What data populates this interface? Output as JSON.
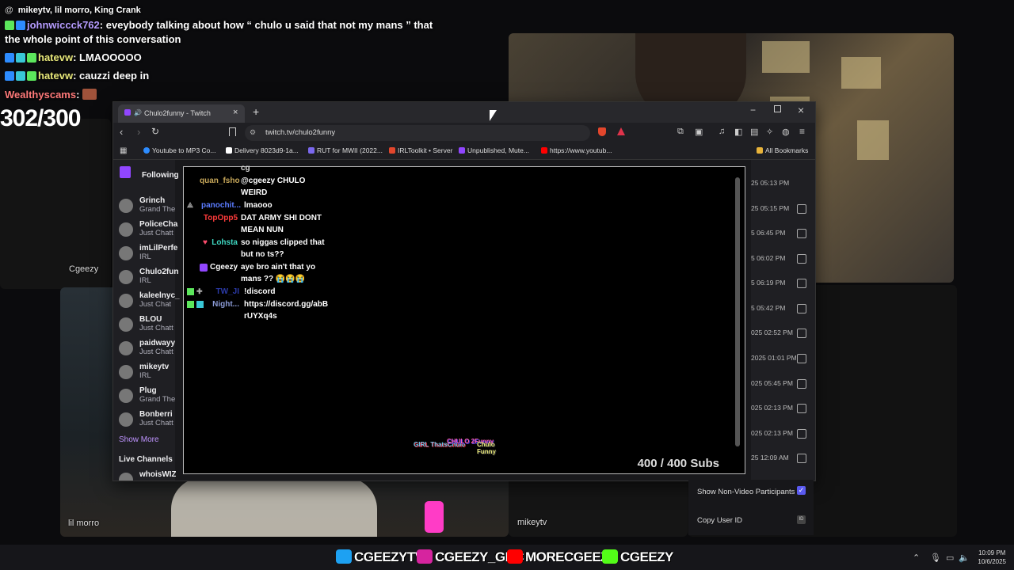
{
  "overlay_chat": {
    "header": "mikeytv, lil morro, King Crank",
    "messages": [
      {
        "user": "johnwiccck762",
        "text": "eveybody talking about how “ chulo u said that not my mans ” that",
        "cont": "the whole point of this conversation",
        "color": "#b69cff"
      },
      {
        "user": "hatevw",
        "text": "LMAOOOOO",
        "color": "#e8e87a"
      },
      {
        "user": "hatevw",
        "text": "cauzzi deep in",
        "color": "#e8e87a"
      },
      {
        "user": "Wealthyscams",
        "text": "",
        "color": "#ff7a7a"
      }
    ],
    "counter": "302/300"
  },
  "tiles": {
    "cgeezy": "Cgeezy",
    "lil_morro": "lil morro",
    "mikeytv": "mikeytv"
  },
  "browser": {
    "tab_title": "Chulo2funny - Twitch",
    "new_tab": "+",
    "url": "twitch.tv/chulo2funny",
    "bookmarks": [
      "Youtube to MP3 Co...",
      "Delivery 8023d9-1a...",
      "RUT for MWII (2022...",
      "IRLToolkit • Server",
      "Unpublished, Mute...",
      "https://www.youtub..."
    ],
    "all_bookmarks": "All Bookmarks"
  },
  "sidebar": {
    "following": "Following",
    "channels": [
      {
        "name": "Grinch",
        "status": "Grand The"
      },
      {
        "name": "PoliceCha",
        "status": "Just Chatt"
      },
      {
        "name": "imLilPerfe",
        "status": "IRL"
      },
      {
        "name": "Chulo2fun",
        "status": "IRL"
      },
      {
        "name": "kaleelnyc_",
        "status": "Just Chat"
      },
      {
        "name": "BLOU",
        "status": "Just Chatt"
      },
      {
        "name": "paidwayy",
        "status": "Just Chatt"
      },
      {
        "name": "mikeytv",
        "status": "IRL"
      },
      {
        "name": "Plug",
        "status": "Grand The"
      },
      {
        "name": "Bonberri",
        "status": "Just Chatt"
      }
    ],
    "show_more": "Show More",
    "live_channels": "Live Channels",
    "live_first": "whoisWIZ"
  },
  "stream_chat": [
    {
      "user": "",
      "lines": [
        "cg"
      ]
    },
    {
      "user": "quan_fsho",
      "lines": [
        "@cgeezy CHULO",
        "WEIRD"
      ],
      "color": "#c8a85a"
    },
    {
      "user": "panochit...",
      "lines": [
        "lmaooo"
      ],
      "color": "#5b7cff"
    },
    {
      "user": "TopOpp5",
      "lines": [
        "DAT ARMY SHI DONT",
        "MEAN NUN"
      ],
      "color": "#ff3b3b"
    },
    {
      "user": "Lohsta",
      "lines": [
        "so niggas clipped that",
        "but no ts??"
      ],
      "color": "#3ed6c0"
    },
    {
      "user": "Cgeezy",
      "lines": [
        "aye bro ain't that yo",
        "mans ?? 😭😭😭"
      ],
      "color": "#ffffff"
    },
    {
      "user": "TW_JI",
      "lines": [
        "!discord"
      ],
      "color": "#2b3aa8"
    },
    {
      "user": "Night...",
      "lines": [
        "https://discord.gg/abB",
        "rUYXq4s"
      ],
      "color": "#8b9bd6"
    }
  ],
  "subs_goal": "400 / 400 Subs",
  "stream_logos": [
    "GIRL ThatsChulo",
    "CHULO 2Funny",
    "Chulo Funny"
  ],
  "right_list": [
    "25 05:13 PM",
    "25 05:15 PM",
    "5 06:45 PM",
    "5 06:02 PM",
    "5 06:19 PM",
    "5 05:42 PM",
    "025 02:52 PM",
    "2025 01:01 PM",
    "025 05:45 PM",
    "025 02:13 PM",
    "025 02:13 PM",
    "25 12:09 AM"
  ],
  "options": {
    "show_non_video": "Show Non-Video Participants",
    "copy_user_id": "Copy User ID",
    "show_non_video_checked": true
  },
  "footer": {
    "socials": [
      "CGEEZYTV",
      "CGEEZY_GBC",
      "MORECGEEZY",
      "CGEEZY"
    ],
    "social_colors": [
      "#1da1f2",
      "#d6249f",
      "#ff0000",
      "#53fc18"
    ],
    "time": "10:09 PM",
    "date": "10/6/2025"
  }
}
